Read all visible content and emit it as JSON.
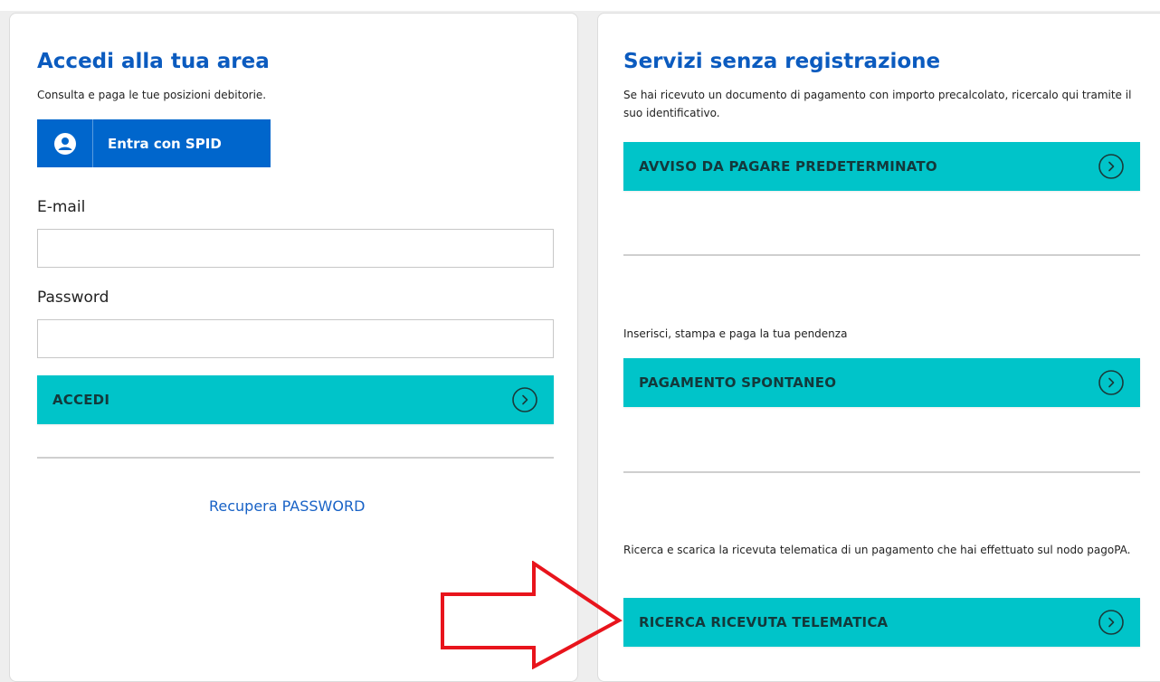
{
  "login": {
    "title": "Accedi alla tua area",
    "description": "Consulta e paga le tue posizioni debitorie.",
    "spid_label": "Entra con SPID",
    "email_label": "E-mail",
    "email_value": "",
    "password_label": "Password",
    "password_value": "",
    "submit_label": "ACCEDI",
    "recover_label": "Recupera PASSWORD"
  },
  "services": {
    "title": "Servizi senza registrazione",
    "items": [
      {
        "description": "Se hai ricevuto un documento di pagamento con importo precalcolato, ricercalo qui tramite il suo identificativo.",
        "button_label": "AVVISO DA PAGARE PREDETERMINATO"
      },
      {
        "description": "Inserisci, stampa e paga la tua pendenza",
        "button_label": "PAGAMENTO SPONTANEO"
      },
      {
        "description": "Ricerca e scarica la ricevuta telematica di un pagamento che hai effettuato sul nodo pagoPA.",
        "button_label": "RICERCA RICEVUTA TELEMATICA"
      }
    ]
  },
  "colors": {
    "title_blue": "#0b5bbf",
    "spid_blue": "#0066cc",
    "teal": "#00c4c9",
    "arrow_red": "#e8141c"
  },
  "icons": {
    "spid": "user-circle-icon",
    "button_arrow": "chevron-right-circle-icon",
    "annotation": "red-outline-arrow"
  }
}
